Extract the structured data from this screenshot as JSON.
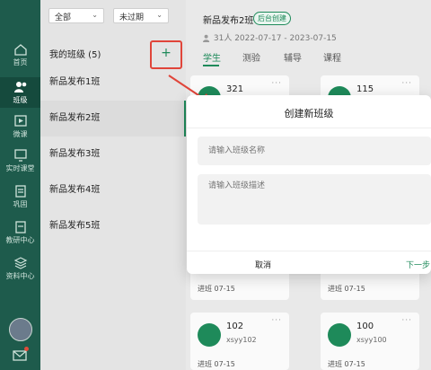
{
  "nav": {
    "items": [
      {
        "label": "首页",
        "icon": "home-icon"
      },
      {
        "label": "班级",
        "icon": "class-users-icon"
      },
      {
        "label": "微课",
        "icon": "microclass-icon"
      },
      {
        "label": "实时课堂",
        "icon": "live-class-icon"
      },
      {
        "label": "巩固",
        "icon": "practice-icon"
      },
      {
        "label": "教研中心",
        "icon": "research-icon"
      },
      {
        "label": "资料中心",
        "icon": "materials-icon"
      }
    ]
  },
  "filters": {
    "left": "全部",
    "right": "未过期"
  },
  "my_classes": {
    "title": "我的班级 (5)",
    "add_icon": "+"
  },
  "classes": [
    "新品发布1班",
    "新品发布2班",
    "新品发布3班",
    "新品发布4班",
    "新品发布5班"
  ],
  "main": {
    "class_name": "新品发布2班",
    "tag": "后台创建",
    "meta": "31人  2022-07-17 - 2023-07-15",
    "tabs": [
      "学生",
      "测验",
      "辅导",
      "课程"
    ]
  },
  "cards": [
    {
      "num": "321",
      "sub": "",
      "join": ""
    },
    {
      "num": "115",
      "sub": "",
      "join": ""
    },
    {
      "num": "",
      "sub": "",
      "join": "进班 07-15"
    },
    {
      "num": "",
      "sub": "",
      "join": "进班 07-15"
    },
    {
      "num": "102",
      "sub": "xsyy102",
      "join": "进班 07-15"
    },
    {
      "num": "100",
      "sub": "xsyy100",
      "join": "进班 07-15"
    }
  ],
  "dialog": {
    "title": "创建新班级",
    "name_placeholder": "请输入班级名称",
    "desc_placeholder": "请输入班级描述",
    "cancel": "取消",
    "next": "下一步"
  },
  "colors": {
    "primary": "#1e8a5a",
    "nav_bg": "#1e5b4c",
    "highlight": "#e0453a"
  }
}
